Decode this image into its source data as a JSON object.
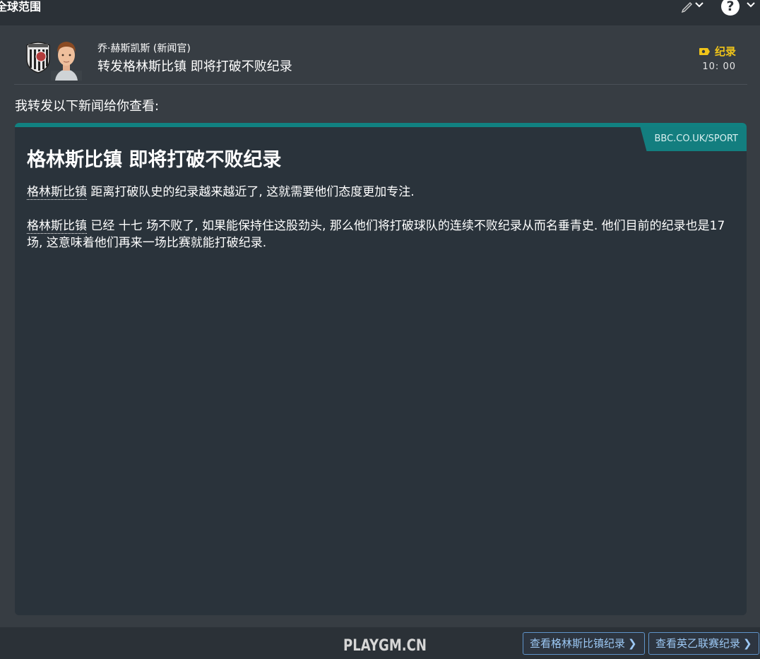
{
  "topbar": {
    "title": "全球范围",
    "edit_icon": "pencil-icon",
    "help_icon": "help-icon"
  },
  "message": {
    "sender": "乔·赫斯凯斯 (新闻官)",
    "subject": "转发格林斯比镇 即将打破不败纪录",
    "tag_label": "纪录",
    "time": "10: 00",
    "tag_color": "#f0c419"
  },
  "body": {
    "intro": "我转发以下新闻给你查看:",
    "source": "BBC.CO.UK/SPORT",
    "headline": "格林斯比镇 即将打破不败纪录",
    "para1_team": "格林斯比镇",
    "para1_rest": " 距离打破队史的纪录越来越近了, 这就需要他们态度更加专注.",
    "para2_team": "格林斯比镇",
    "para2_rest": " 已经 十七 场不败了, 如果能保持住这股劲头, 那么他们将打破球队的连续不败纪录从而名垂青史. 他们目前的纪录也是17场, 这意味着他们再来一场比赛就能打破纪录.",
    "accent_color": "#118181"
  },
  "footer": {
    "watermark": "PLAYGM.CN",
    "button1": "查看格林斯比镇纪录",
    "button2": "查看英乙联赛纪录"
  }
}
